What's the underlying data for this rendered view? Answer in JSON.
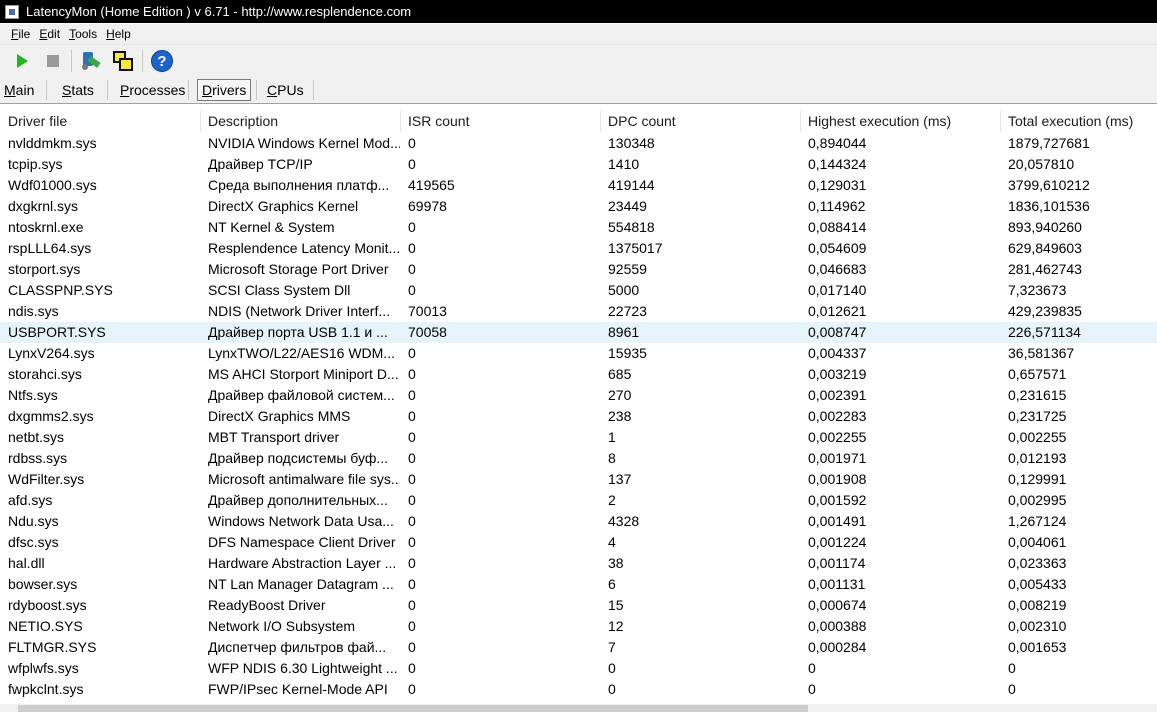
{
  "window": {
    "title": "LatencyMon  (Home Edition )  v 6.71 - http://www.resplendence.com"
  },
  "menu": [
    "File",
    "Edit",
    "Tools",
    "Help"
  ],
  "toolbar": {
    "buttons": [
      {
        "name": "start",
        "icon": "play-icon"
      },
      {
        "name": "stop",
        "icon": "stop-icon"
      },
      {
        "name": "tools",
        "icon": "tools-icon"
      },
      {
        "name": "windows",
        "icon": "windows-icon"
      },
      {
        "name": "help",
        "icon": "help-icon",
        "glyph": "?"
      }
    ]
  },
  "tabs": [
    {
      "label": "Main",
      "active": false
    },
    {
      "label": "Stats",
      "active": false
    },
    {
      "label": "Processes",
      "active": false
    },
    {
      "label": "Drivers",
      "active": true
    },
    {
      "label": "CPUs",
      "active": false
    }
  ],
  "table": {
    "columns": [
      "Driver file",
      "Description",
      "ISR count",
      "DPC count",
      "Highest execution (ms)",
      "Total execution (ms)"
    ],
    "selected_index": 9,
    "rows": [
      [
        "nvlddmkm.sys",
        "NVIDIA Windows Kernel Mod...",
        "0",
        "130348",
        "0,894044",
        "1879,727681"
      ],
      [
        "tcpip.sys",
        "Драйвер TCP/IP",
        "0",
        "1410",
        "0,144324",
        "20,057810"
      ],
      [
        "Wdf01000.sys",
        "Среда выполнения платф...",
        "419565",
        "419144",
        "0,129031",
        "3799,610212"
      ],
      [
        "dxgkrnl.sys",
        "DirectX Graphics Kernel",
        "69978",
        "23449",
        "0,114962",
        "1836,101536"
      ],
      [
        "ntoskrnl.exe",
        "NT Kernel & System",
        "0",
        "554818",
        "0,088414",
        "893,940260"
      ],
      [
        "rspLLL64.sys",
        "Resplendence Latency Monit...",
        "0",
        "1375017",
        "0,054609",
        "629,849603"
      ],
      [
        "storport.sys",
        "Microsoft Storage Port Driver",
        "0",
        "92559",
        "0,046683",
        "281,462743"
      ],
      [
        "CLASSPNP.SYS",
        "SCSI Class System Dll",
        "0",
        "5000",
        "0,017140",
        "7,323673"
      ],
      [
        "ndis.sys",
        "NDIS (Network Driver Interf...",
        "70013",
        "22723",
        "0,012621",
        "429,239835"
      ],
      [
        "USBPORT.SYS",
        "Драйвер порта USB 1.1 и ...",
        "70058",
        "8961",
        "0,008747",
        "226,571134"
      ],
      [
        "LynxV264.sys",
        "LynxTWO/L22/AES16 WDM...",
        "0",
        "15935",
        "0,004337",
        "36,581367"
      ],
      [
        "storahci.sys",
        "MS AHCI Storport Miniport D...",
        "0",
        "685",
        "0,003219",
        "0,657571"
      ],
      [
        "Ntfs.sys",
        "Драйвер файловой систем...",
        "0",
        "270",
        "0,002391",
        "0,231615"
      ],
      [
        "dxgmms2.sys",
        "DirectX Graphics MMS",
        "0",
        "238",
        "0,002283",
        "0,231725"
      ],
      [
        "netbt.sys",
        "MBT Transport driver",
        "0",
        "1",
        "0,002255",
        "0,002255"
      ],
      [
        "rdbss.sys",
        "Драйвер подсистемы буф...",
        "0",
        "8",
        "0,001971",
        "0,012193"
      ],
      [
        "WdFilter.sys",
        "Microsoft antimalware file sys...",
        "0",
        "137",
        "0,001908",
        "0,129991"
      ],
      [
        "afd.sys",
        "Драйвер дополнительных...",
        "0",
        "2",
        "0,001592",
        "0,002995"
      ],
      [
        "Ndu.sys",
        "Windows Network Data Usa...",
        "0",
        "4328",
        "0,001491",
        "1,267124"
      ],
      [
        "dfsc.sys",
        "DFS Namespace Client Driver",
        "0",
        "4",
        "0,001224",
        "0,004061"
      ],
      [
        "hal.dll",
        "Hardware Abstraction Layer ...",
        "0",
        "38",
        "0,001174",
        "0,023363"
      ],
      [
        "bowser.sys",
        "NT Lan Manager Datagram ...",
        "0",
        "6",
        "0,001131",
        "0,005433"
      ],
      [
        "rdyboost.sys",
        "ReadyBoost Driver",
        "0",
        "15",
        "0,000674",
        "0,008219"
      ],
      [
        "NETIO.SYS",
        "Network I/O Subsystem",
        "0",
        "12",
        "0,000388",
        "0,002310"
      ],
      [
        "FLTMGR.SYS",
        "Диспетчер фильтров фай...",
        "0",
        "7",
        "0,000284",
        "0,001653"
      ],
      [
        "wfplwfs.sys",
        "WFP NDIS 6.30 Lightweight ...",
        "0",
        "0",
        "0",
        "0"
      ],
      [
        "fwpkclnt.sys",
        "FWP/IPsec Kernel-Mode API",
        "0",
        "0",
        "0",
        "0"
      ]
    ]
  }
}
